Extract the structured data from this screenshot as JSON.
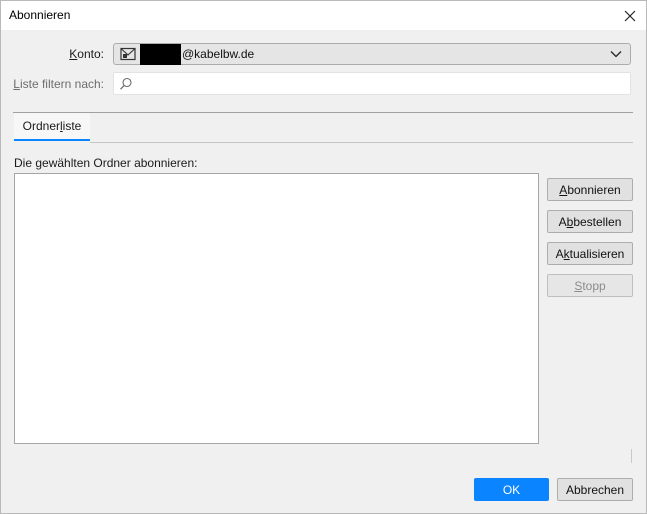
{
  "window": {
    "title": "Abonnieren"
  },
  "account": {
    "label_pre": "",
    "label_ul": "K",
    "label_post": "onto:",
    "email_suffix": "@kabelbw.de",
    "icon": "mail-account-icon"
  },
  "filter": {
    "label_ul": "L",
    "label_post": "iste filtern nach:",
    "value": "",
    "placeholder": "",
    "icon": "search-icon"
  },
  "tabs": [
    {
      "label_pre": "Ordner",
      "label_ul": "l",
      "label_post": "iste",
      "active": true
    }
  ],
  "list": {
    "heading": "Die gewählten Ordner abonnieren:",
    "items": []
  },
  "actions": {
    "subscribe": {
      "pre": "",
      "ul": "A",
      "post": "bonnieren"
    },
    "unsubscribe": {
      "pre": "A",
      "ul": "b",
      "post": "bestellen"
    },
    "refresh": {
      "pre": "A",
      "ul": "k",
      "post": "tualisieren"
    },
    "stop": {
      "pre": "",
      "ul": "S",
      "post": "topp",
      "disabled": true
    }
  },
  "footer": {
    "ok": "OK",
    "cancel": "Abbrechen"
  },
  "colors": {
    "accent": "#0a84ff",
    "dialog_bg": "#f0f0f0"
  }
}
